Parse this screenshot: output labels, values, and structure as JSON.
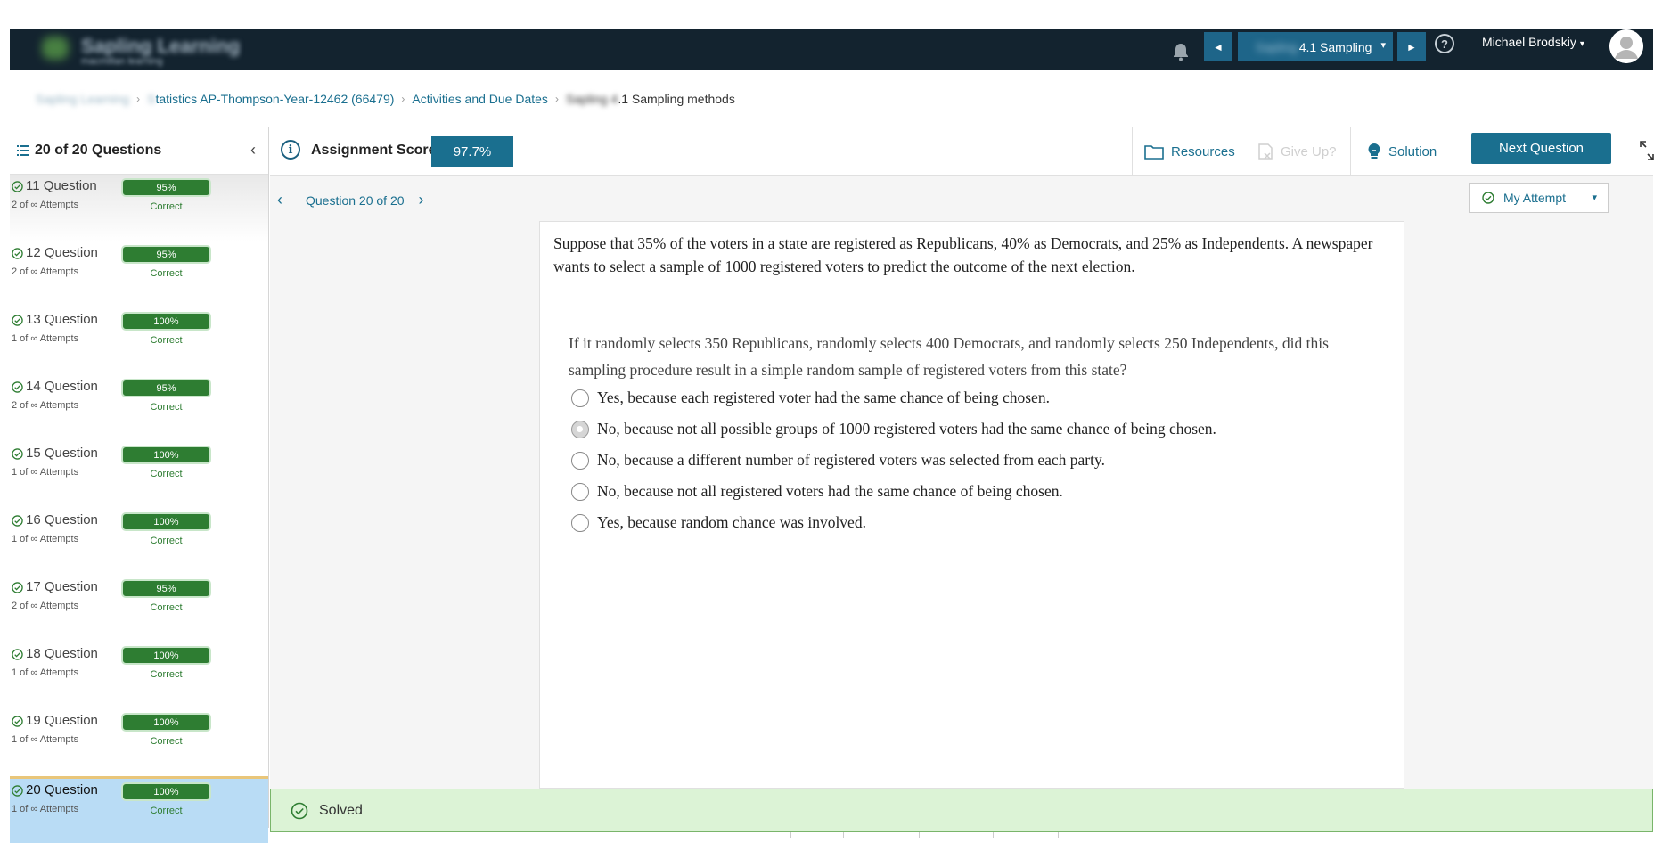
{
  "topbar": {
    "logo_text": "Sapling Learning",
    "logo_subtext": "macmillan learning",
    "assignment_blurred": "Sapling",
    "assignment_label": "4.1 Sampling",
    "prev_label": "◄",
    "next_label": "►",
    "help_label": "?",
    "user_name": "Michael Brodskiy",
    "caret": "▾"
  },
  "breadcrumb": {
    "home": "Sapling Learning",
    "course_prefix": "S",
    "course": "tatistics AP-Thompson-Year-12462 (66479)",
    "activities": "Activities and Due Dates",
    "current_prefix": "Sapling 4",
    "current": ".1 Sampling methods",
    "sep": "›"
  },
  "sidebar": {
    "title": "20 of 20 Questions",
    "collapse": "‹",
    "items": [
      {
        "name": "11 Question",
        "attempts": "2 of ∞ Attempts",
        "score": "95%",
        "status": "Correct"
      },
      {
        "name": "12 Question",
        "attempts": "2 of ∞ Attempts",
        "score": "95%",
        "status": "Correct"
      },
      {
        "name": "13 Question",
        "attempts": "1 of ∞ Attempts",
        "score": "100%",
        "status": "Correct"
      },
      {
        "name": "14 Question",
        "attempts": "2 of ∞ Attempts",
        "score": "95%",
        "status": "Correct"
      },
      {
        "name": "15 Question",
        "attempts": "1 of ∞ Attempts",
        "score": "100%",
        "status": "Correct"
      },
      {
        "name": "16 Question",
        "attempts": "1 of ∞ Attempts",
        "score": "100%",
        "status": "Correct"
      },
      {
        "name": "17 Question",
        "attempts": "2 of ∞ Attempts",
        "score": "95%",
        "status": "Correct"
      },
      {
        "name": "18 Question",
        "attempts": "1 of ∞ Attempts",
        "score": "100%",
        "status": "Correct"
      },
      {
        "name": "19 Question",
        "attempts": "1 of ∞ Attempts",
        "score": "100%",
        "status": "Correct"
      },
      {
        "name": "20 Question",
        "attempts": "1 of ∞ Attempts",
        "score": "100%",
        "status": "Correct"
      }
    ]
  },
  "toolbar": {
    "info": "i",
    "score_label": "Assignment Score:",
    "score_value": "97.7%",
    "resources": "Resources",
    "give_up": "Give Up?",
    "solution": "Solution",
    "next_question": "Next Question"
  },
  "question": {
    "prev": "‹",
    "next": "›",
    "nav_label": "Question 20 of 20",
    "attempt_label": "My Attempt",
    "attempt_caret": "▾",
    "stem": "Suppose that 35% of the voters in a state are registered as Republicans, 40% as Democrats, and 25% as Independents. A newspaper wants to select a sample of 1000 registered voters to predict the outcome of the next election.",
    "prompt": "If it randomly selects 350 Republicans, randomly selects 400 Democrats, and randomly selects 250 Independents, did this sampling procedure result in a simple random sample of registered voters from this state?",
    "choices": [
      "Yes, because each registered voter had the same chance of being chosen.",
      "No, because not all possible groups of 1000 registered voters had the same chance of being chosen.",
      "No, because a different number of registered voters was selected from each party.",
      "No, because not all registered voters had the same chance of being chosen.",
      "Yes, because random chance was involved."
    ],
    "selected_index": 1
  },
  "status": {
    "solved_label": "Solved"
  },
  "colors": {
    "topbar": "#13232f",
    "accent": "#1a6f8f",
    "success": "#2e7d32",
    "solved_bg": "#dcf3d6",
    "active_item": "#b9dcf5"
  },
  "icons": [
    "bell-icon",
    "help-icon",
    "avatar-icon",
    "list-icon",
    "collapse-icon",
    "info-icon",
    "folder-icon",
    "give-up-icon",
    "lightbulb-icon",
    "expand-icon",
    "check-circle-icon"
  ]
}
